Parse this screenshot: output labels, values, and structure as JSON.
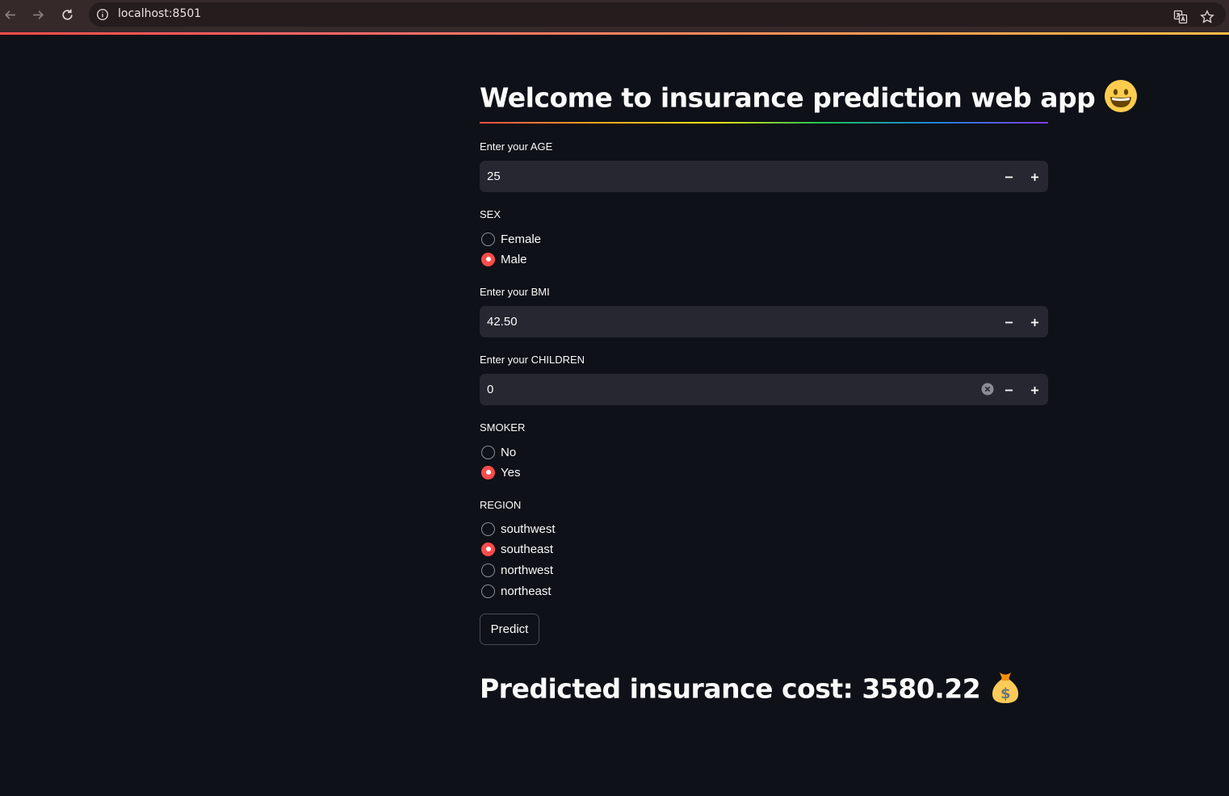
{
  "browser": {
    "url": "localhost:8501"
  },
  "app": {
    "title": "Welcome to insurance prediction web app",
    "title_emoji": "grinning-face",
    "age": {
      "label": "Enter your AGE",
      "value": "25"
    },
    "sex": {
      "label": "SEX",
      "options": [
        "Female",
        "Male"
      ],
      "selected": "Male"
    },
    "bmi": {
      "label": "Enter your BMI",
      "value": "42.50"
    },
    "children": {
      "label": "Enter your CHILDREN",
      "value": "0"
    },
    "smoker": {
      "label": "SMOKER",
      "options": [
        "No",
        "Yes"
      ],
      "selected": "Yes"
    },
    "region": {
      "label": "REGION",
      "options": [
        "southwest",
        "southeast",
        "northwest",
        "northeast"
      ],
      "selected": "southeast"
    },
    "predict_label": "Predict",
    "result_text": "Predicted insurance cost: 3580.22",
    "result_emoji": "money-bag"
  },
  "colors": {
    "background": "#0e1117",
    "input_bg": "#262730",
    "accent": "#ff4b4b"
  }
}
